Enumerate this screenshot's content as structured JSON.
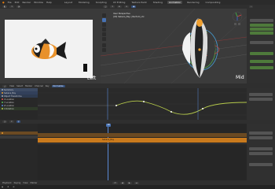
{
  "menubar": {
    "menus": [
      "File",
      "Edit",
      "Render",
      "Window",
      "Help"
    ],
    "workspaces": [
      "Layout",
      "Modeling",
      "Sculpting",
      "UV Editing",
      "Texture Paint",
      "Shading",
      "Animation",
      "Rendering",
      "Compositing"
    ],
    "active_workspace": "Animation"
  },
  "camera_view": {
    "label": "Left"
  },
  "viewport": {
    "overlay_line1": "User Perspective",
    "overlay_line2": "(18) Sabaca_Bay | Rectum_Ltx",
    "side_label": "Mid"
  },
  "graph_editor": {
    "header": [
      "View",
      "Select",
      "Marker",
      "Channel",
      "Key"
    ],
    "channels": [
      "Summary",
      "Sabaca_Bay",
      "Object Transforms",
      "X Location",
      "Y Location",
      "Z Location",
      "X Rotation"
    ],
    "normalize": "Normalize"
  },
  "timeline": {
    "header": [
      "Playback",
      "Keying",
      "View",
      "Marker"
    ],
    "current_frame": "18",
    "strip_label": "Sabaca_Bay"
  },
  "colors": {
    "accent": "#4772b3",
    "selection_orange": "#e69a2c",
    "curve_green": "#b4c84a",
    "playhead": "#5b8ad6",
    "strip_orange": "#c97a1d"
  },
  "icons": [
    "camera-icon",
    "cursor-icon",
    "move-icon",
    "rotate-icon",
    "scale-icon",
    "transform-icon",
    "annotate-icon",
    "measure-icon"
  ]
}
